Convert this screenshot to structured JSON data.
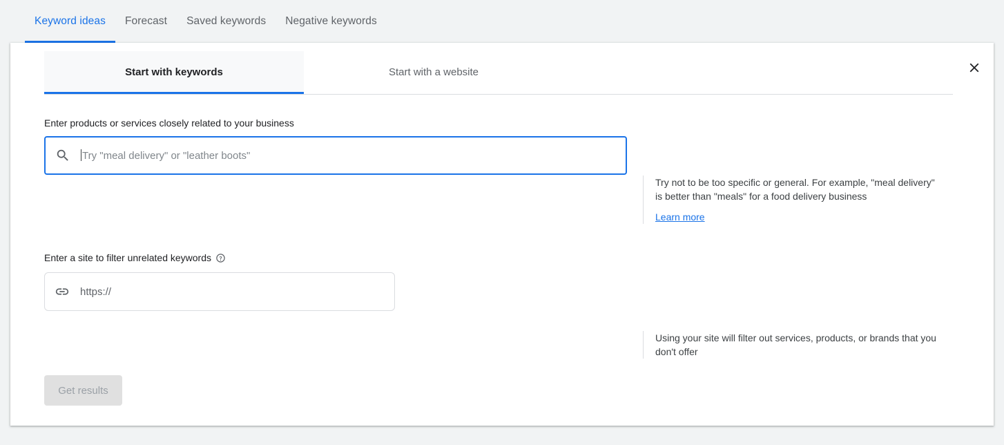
{
  "topnav": {
    "tabs": [
      {
        "label": "Keyword ideas",
        "active": true
      },
      {
        "label": "Forecast",
        "active": false
      },
      {
        "label": "Saved keywords",
        "active": false
      },
      {
        "label": "Negative keywords",
        "active": false
      }
    ]
  },
  "card": {
    "close_icon": "close-icon",
    "inner_tabs": [
      {
        "label": "Start with keywords",
        "active": true
      },
      {
        "label": "Start with a website",
        "active": false
      }
    ],
    "keywords_field": {
      "label": "Enter products or services closely related to your business",
      "icon": "search-icon",
      "value": "",
      "placeholder": "Try \"meal delivery\" or \"leather boots\"",
      "focused": true
    },
    "keywords_hint": {
      "text": "Try not to be too specific or general. For example, \"meal delivery\" is better than \"meals\" for a food delivery business",
      "link_label": "Learn more"
    },
    "site_field": {
      "label": "Enter a site to filter unrelated keywords",
      "help_icon": "help-circle-icon",
      "icon": "link-icon",
      "value": "",
      "placeholder": "https://"
    },
    "site_hint": {
      "text": "Using your site will filter out services, products, or brands that you don't offer"
    },
    "submit": {
      "label": "Get results",
      "disabled": true
    }
  },
  "colors": {
    "accent": "#1a73e8",
    "page_background": "#f1f3f4",
    "card_background": "#ffffff",
    "disabled_button": "#e0e0e0",
    "divider": "#dadce0"
  }
}
